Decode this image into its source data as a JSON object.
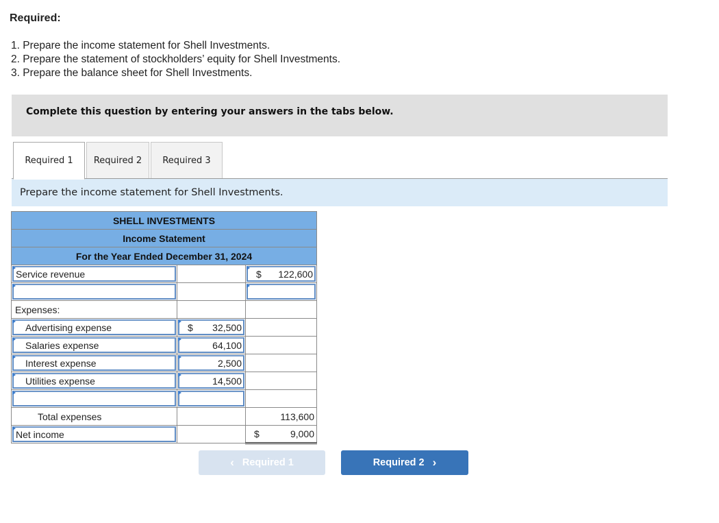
{
  "required": {
    "heading": "Required:",
    "items": [
      "1. Prepare the income statement for Shell Investments.",
      "2. Prepare the statement of stockholders’ equity for Shell Investments.",
      "3. Prepare the balance sheet for Shell Investments."
    ]
  },
  "instruction": "Complete this question by entering your answers in the tabs below.",
  "tabs": [
    {
      "label": "Required 1",
      "active": true
    },
    {
      "label": "Required 2",
      "active": false
    },
    {
      "label": "Required 3",
      "active": false
    }
  ],
  "prompt": "Prepare the income statement for Shell Investments.",
  "statement": {
    "company": "SHELL INVESTMENTS",
    "title": "Income Statement",
    "period": "For the Year Ended December 31, 2024",
    "rows": {
      "service_revenue": {
        "label": "Service revenue",
        "right_dollar": "$",
        "right_value": "122,600"
      },
      "blank_revenue": {
        "label": "",
        "right_value": ""
      },
      "expenses_header": {
        "label": "Expenses:"
      },
      "advertising": {
        "label": "Advertising expense",
        "dollar": "$",
        "value": "32,500"
      },
      "salaries": {
        "label": "Salaries expense",
        "value": "64,100"
      },
      "interest": {
        "label": "Interest expense",
        "value": "2,500"
      },
      "utilities": {
        "label": "Utilities expense",
        "value": "14,500"
      },
      "blank_expense": {
        "label": "",
        "value": ""
      },
      "total_expenses": {
        "label": "Total expenses",
        "right_value": "113,600"
      },
      "net_income": {
        "label": "Net income",
        "right_dollar": "$",
        "right_value": "9,000"
      }
    }
  },
  "nav": {
    "prev_label": "Required 1",
    "prev_icon": "‹",
    "next_label": "Required 2",
    "next_icon": "›"
  },
  "colors": {
    "header_blue": "#77aee4",
    "next_button": "#3874b8",
    "prev_button_disabled": "#d8e3f0",
    "prompt_bg": "#dbebf8",
    "instruction_bg": "#e0e0e0"
  }
}
